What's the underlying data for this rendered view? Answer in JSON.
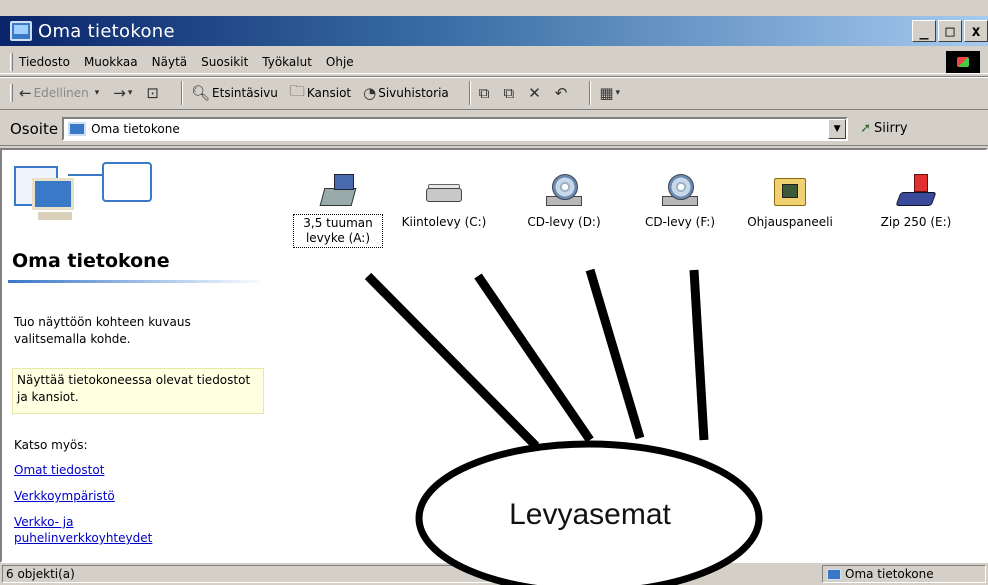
{
  "window": {
    "title": "Oma tietokone",
    "controls": {
      "minimize": "_",
      "maximize": "□",
      "close": "x"
    }
  },
  "menu": {
    "items": [
      "Tiedosto",
      "Muokkaa",
      "Näytä",
      "Suosikit",
      "Työkalut",
      "Ohje"
    ]
  },
  "toolbar": {
    "back": "Edellinen",
    "search": "Etsintäsivu",
    "folders": "Kansiot",
    "history": "Sivuhistoria"
  },
  "address": {
    "label": "Osoite",
    "value": "Oma tietokone",
    "go": "Siirry"
  },
  "sidebar": {
    "title": "Oma tietokone",
    "description": "Tuo näyttöön kohteen kuvaus valitsemalla kohde.",
    "info": "Näyttää tietokoneessa olevat tiedostot ja kansiot.",
    "see_also": "Katso myös:",
    "links": [
      "Omat tiedostot",
      "Verkkoympäristö",
      "Verkko- ja puhelinverkkoyhteydet"
    ]
  },
  "icons": [
    {
      "label": "3,5 tuuman levyke (A:)",
      "type": "floppy-icon",
      "selected": true
    },
    {
      "label": "Kiintolevy (C:)",
      "type": "hard-drive-icon"
    },
    {
      "label": "CD-levy (D:)",
      "type": "cd-drive-icon"
    },
    {
      "label": "CD-levy (F:)",
      "type": "cd-drive-icon"
    },
    {
      "label": "Ohjauspaneeli",
      "type": "control-panel-icon"
    },
    {
      "label": "Zip 250 (E:)",
      "type": "zip-drive-icon"
    }
  ],
  "status": {
    "left": "6 objekti(a)",
    "right": "Oma tietokone"
  },
  "annotation": {
    "label": "Levyasemat"
  }
}
